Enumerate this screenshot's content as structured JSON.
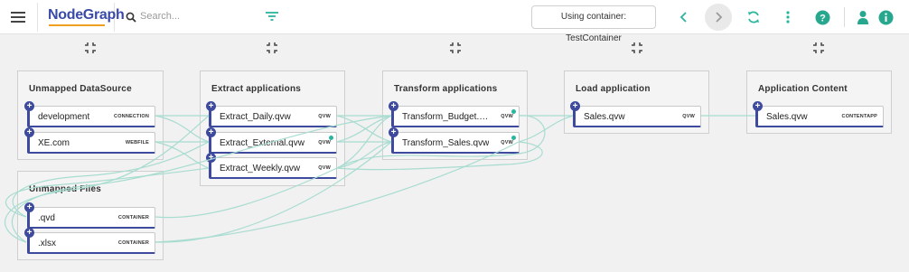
{
  "brand": {
    "name": "NodeGraph"
  },
  "search": {
    "placeholder": "Search..."
  },
  "toolbar": {
    "container_label": "Using container: TestContainer"
  },
  "colors": {
    "accent": "#3d4a9e",
    "edge": "#a8dcd0",
    "teal": "#29b59e",
    "help": "#27a88e",
    "warn_dot": "#2bb5a0"
  },
  "groups": [
    {
      "title": "Unmapped DataSource",
      "nodes": [
        {
          "label": "development",
          "type": "CONNECTION"
        },
        {
          "label": "XE.com",
          "type": "WEBFILE"
        }
      ]
    },
    {
      "title": "Extract applications",
      "nodes": [
        {
          "label": "Extract_Daily.qvw",
          "type": "QVW"
        },
        {
          "label": "Extract_External.qvw",
          "type": "QVW"
        },
        {
          "label": "Extract_Weekly.qvw",
          "type": "QVW"
        }
      ]
    },
    {
      "title": "Transform applications",
      "nodes": [
        {
          "label": "Transform_Budget.q...",
          "type": "QVW"
        },
        {
          "label": "Transform_Sales.qvw",
          "type": "QVW"
        }
      ]
    },
    {
      "title": "Load application",
      "nodes": [
        {
          "label": "Sales.qvw",
          "type": "QVW"
        }
      ]
    },
    {
      "title": "Application Content",
      "nodes": [
        {
          "label": "Sales.qvw",
          "type": "CONTENTAPP"
        }
      ]
    },
    {
      "title": "Unmapped Files",
      "nodes": [
        {
          "label": ".qvd",
          "type": "CONTAINER"
        },
        {
          "label": ".xlsx",
          "type": "CONTAINER"
        }
      ]
    }
  ]
}
